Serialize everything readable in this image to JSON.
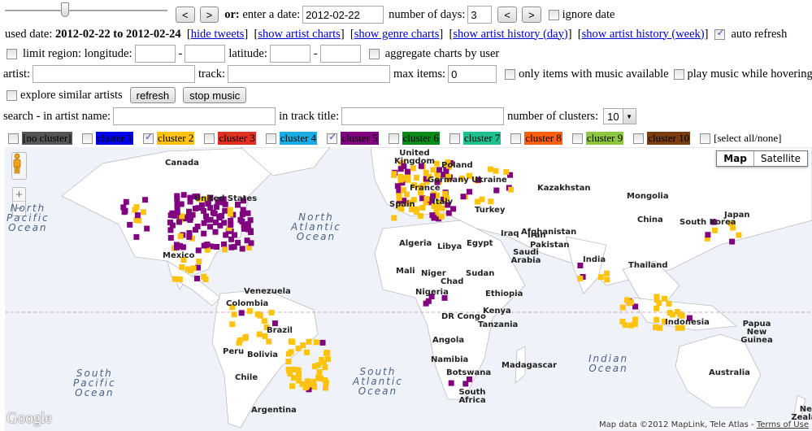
{
  "controls": {
    "date_slider": {
      "position_fraction": 0.37
    },
    "prev_label": "<",
    "next_label": ">",
    "or_label": "or:",
    "enter_date_label": "enter a date:",
    "date_value": "2012-02-22",
    "num_days_label": "number of days:",
    "num_days_value": "3",
    "ignore_date_label": "ignore date",
    "ignore_date_checked": false
  },
  "used_date": {
    "prefix": "used date:",
    "range": "2012-02-22 to 2012-02-24",
    "links": [
      "hide tweets",
      "show artist charts",
      "show genre charts",
      "show artist history (day)",
      "show artist history (week)"
    ],
    "auto_refresh_label": "auto refresh",
    "auto_refresh_checked": true
  },
  "region": {
    "limit_label": "limit region: longitude:",
    "dash": "-",
    "latitude_label": "latitude:",
    "lon_from": "",
    "lon_to": "",
    "lat_from": "",
    "lat_to": "",
    "aggregate_label": "aggregate charts by user"
  },
  "filters": {
    "artist_label": "artist:",
    "artist_value": "",
    "track_label": "track:",
    "track_value": "",
    "max_items_label": "max items:",
    "max_items_value": "0",
    "only_music_label": "only items with music available",
    "play_hover_label": "play music while hovering"
  },
  "actions": {
    "explore_label": "explore similar artists",
    "refresh_label": "refresh",
    "stop_music_label": "stop music"
  },
  "search": {
    "artist_label": "search - in artist name:",
    "artist_value": "",
    "track_label": "in track title:",
    "track_value": "",
    "clusters_label": "number of clusters:",
    "clusters_value": "10"
  },
  "clusters": [
    {
      "label": "[no cluster]",
      "color": "#555555",
      "checked": false
    },
    {
      "label": "cluster 1",
      "color": "#0000ee",
      "checked": false
    },
    {
      "label": "cluster 2",
      "color": "#ffc20e",
      "checked": true
    },
    {
      "label": "cluster 3",
      "color": "#e03020",
      "checked": false
    },
    {
      "label": "cluster 4",
      "color": "#1cace4",
      "checked": false
    },
    {
      "label": "cluster 5",
      "color": "#800080",
      "checked": true
    },
    {
      "label": "cluster 6",
      "color": "#0a8a1a",
      "checked": false
    },
    {
      "label": "cluster 7",
      "color": "#1fbf8f",
      "checked": false
    },
    {
      "label": "cluster 8",
      "color": "#ff6010",
      "checked": false
    },
    {
      "label": "cluster 9",
      "color": "#8dc63f",
      "checked": false
    },
    {
      "label": "cluster 10",
      "color": "#7a3d10",
      "checked": false
    }
  ],
  "select_all_label": "[select all/none]",
  "map": {
    "type_buttons": [
      "Map",
      "Satellite"
    ],
    "active_type": "Map",
    "zoom_in": "+",
    "zoom_out": "−",
    "logo": "Google",
    "attribution": "Map data ©2012 MapLink, Tele Atlas -",
    "terms_label": "Terms of Use",
    "country_labels": [
      "Canada",
      "United States",
      "Mexico",
      "Venezuela",
      "Colombia",
      "Peru",
      "Brazil",
      "Bolivia",
      "Chile",
      "Argentina",
      "United Kingdom",
      "Poland",
      "Germany",
      "France",
      "Spain",
      "Italy",
      "Ukraine",
      "Turkey",
      "Kazakhstan",
      "Mongolia",
      "China",
      "South Korea",
      "Japan",
      "Afghanistan",
      "Iraq",
      "Iran",
      "Pakistan",
      "Saudi Arabia",
      "India",
      "Thailand",
      "Algeria",
      "Libya",
      "Egypt",
      "Mali",
      "Niger",
      "Chad",
      "Sudan",
      "Nigeria",
      "Ethiopia",
      "DR Congo",
      "Kenya",
      "Tanzania",
      "Angola",
      "Namibia",
      "Botswana",
      "South Africa",
      "Madagascar",
      "Indonesia",
      "Papua New Guinea",
      "Australia",
      "New Zealand"
    ],
    "oceans": [
      "North Pacific Ocean",
      "North Atlantic Ocean",
      "South Pacific Ocean",
      "South Atlantic Ocean",
      "Indian Ocean"
    ]
  }
}
